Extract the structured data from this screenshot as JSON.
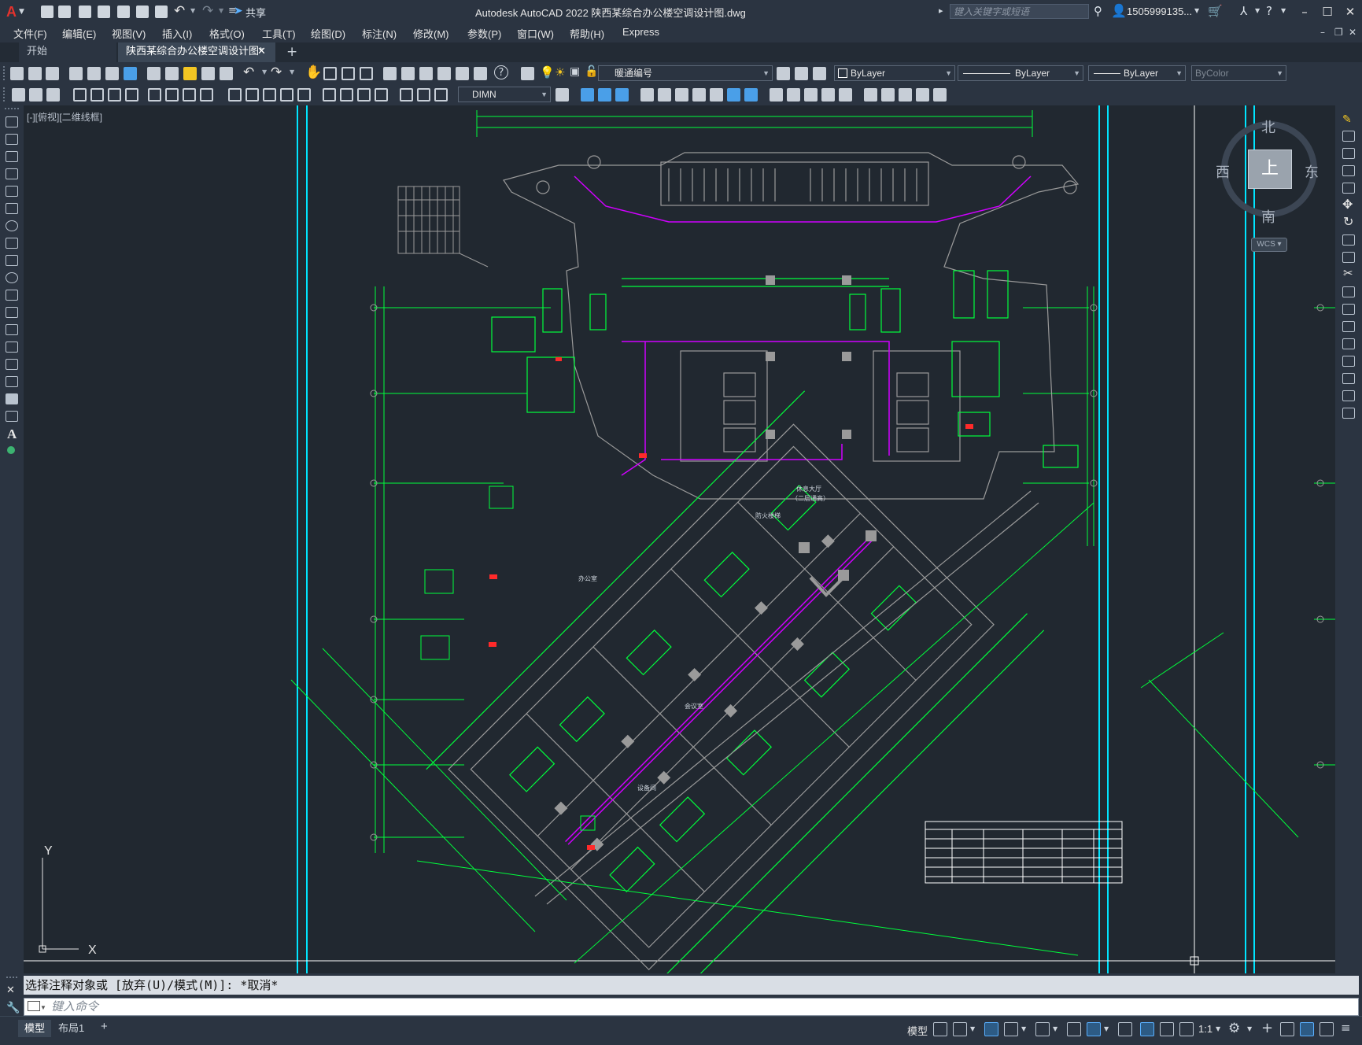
{
  "app": {
    "title": "Autodesk AutoCAD 2022    陕西某综合办公楼空调设计图.dwg",
    "share_label": "共享",
    "search_placeholder": "键入关键字或短语",
    "user": "1505999135...",
    "logo": "A"
  },
  "menu": [
    "文件(F)",
    "编辑(E)",
    "视图(V)",
    "插入(I)",
    "格式(O)",
    "工具(T)",
    "绘图(D)",
    "标注(N)",
    "修改(M)",
    "参数(P)",
    "窗口(W)",
    "帮助(H)",
    "Express"
  ],
  "tabs": [
    {
      "label": "开始"
    },
    {
      "label": "陕西某综合办公楼空调设计图*"
    }
  ],
  "toolbar": {
    "layer": "暖通编号",
    "color": "ByLayer",
    "linetype": "ByLayer",
    "lineweight": "ByLayer",
    "plotstyle": "ByColor",
    "dimstyle": "DIMN"
  },
  "viewport": {
    "label": "[-][俯视][二维线框]"
  },
  "viewcube": {
    "north": "北",
    "south": "南",
    "east": "东",
    "west": "西",
    "face": "上",
    "wcs": "WCS"
  },
  "ucs": {
    "x": "X",
    "y": "Y"
  },
  "drawing_text": {
    "lobby": "休息大厅",
    "lobby_sub": "（二层通高）",
    "fire_stair": "防火楼梯",
    "office": "办公室",
    "meeting": "会议室",
    "equip": "设备间"
  },
  "command": {
    "history": "选择注释对象或 [放弃(U)/模式(M)]: *取消*",
    "placeholder": "键入命令"
  },
  "layout_tabs": [
    {
      "label": "模型",
      "active": true
    },
    {
      "label": "布局1",
      "active": false
    }
  ],
  "status": {
    "model": "模型",
    "scale": "1:1"
  },
  "colors": {
    "green": "#00ff3c",
    "purple": "#d000ff",
    "cyan": "#00e5ff",
    "gray": "#9a9a9a",
    "red": "#ff2a2a"
  }
}
